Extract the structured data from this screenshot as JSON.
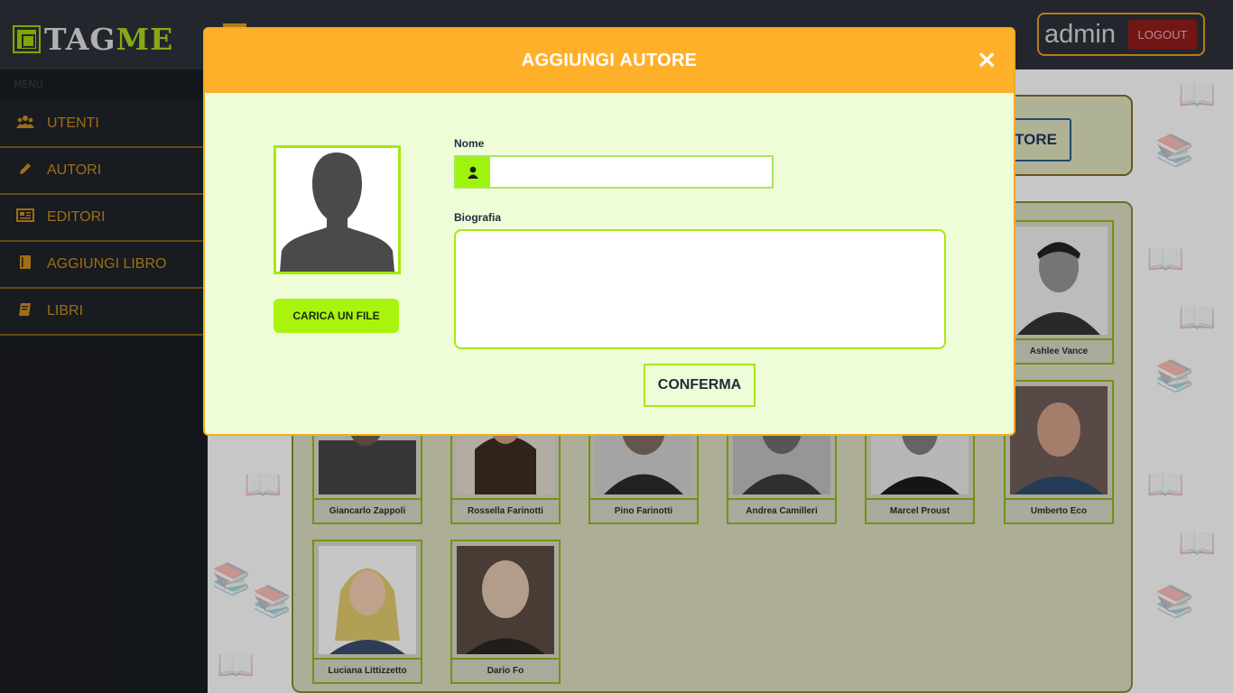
{
  "app": {
    "logo_part1": "TAG",
    "logo_part2": "ME",
    "user_name": "admin",
    "logout_label": "LOGOUT"
  },
  "sidebar": {
    "menu_label": "MENU",
    "items": [
      {
        "label": "UTENTI",
        "icon": "users-icon"
      },
      {
        "label": "AUTORI",
        "icon": "pencil-icon"
      },
      {
        "label": "EDITORI",
        "icon": "newspaper-icon"
      },
      {
        "label": "AGGIUNGI LIBRO",
        "icon": "book-icon"
      },
      {
        "label": "LIBRI",
        "icon": "books-icon"
      }
    ]
  },
  "main": {
    "add_button_label": "TORE",
    "authors": [
      {
        "name": "Ashlee Vance"
      },
      {
        "name": "Giancarlo Zappoli"
      },
      {
        "name": "Rossella Farinotti"
      },
      {
        "name": "Pino Farinotti"
      },
      {
        "name": "Andrea Camilleri"
      },
      {
        "name": "Marcel Proust"
      },
      {
        "name": "Umberto Eco"
      },
      {
        "name": "Luciana Littizzetto"
      },
      {
        "name": "Dario Fo"
      }
    ]
  },
  "modal": {
    "title": "AGGIUNGI AUTORE",
    "close_symbol": "×",
    "upload_label": "CARICA UN FILE",
    "name_label": "Nome",
    "name_value": "",
    "bio_label": "Biografia",
    "bio_value": "",
    "confirm_label": "CONFERMA"
  },
  "colors": {
    "accent_orange": "#ffb02a",
    "accent_green": "#a6e80e",
    "modal_bg": "#eefcd8",
    "sidebar_bg": "#181b21",
    "menu_text": "#c1871c",
    "logout_bg": "#8b1c1c"
  }
}
